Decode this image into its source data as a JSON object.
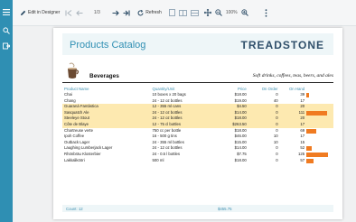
{
  "toolbar": {
    "edit_label": "Edit in Designer",
    "page_value": "1/3",
    "zoom_value": "100%",
    "refresh_label": "Refresh"
  },
  "report": {
    "title": "Products Catalog",
    "brand": "TREADSTONE",
    "category_name": "Beverages",
    "category_desc": "Soft drinks, coffees, teas, beers, and ales",
    "columns": [
      "Product Name",
      "Quantity/Unit",
      "Price",
      "On Order",
      "On Hand"
    ],
    "rows": [
      {
        "name": "Chai",
        "qty": "10 boxes x 20 bags",
        "price": "$18.00",
        "on_order": "0",
        "on_hand": "39"
      },
      {
        "name": "Chang",
        "qty": "24 - 12 oz bottles",
        "price": "$19.00",
        "on_order": "40",
        "on_hand": "17"
      },
      {
        "name": "Guaraná Fantástica",
        "qty": "12 - 355 ml cans",
        "price": "$4.50",
        "on_order": "0",
        "on_hand": "20"
      },
      {
        "name": "Sasquatch Ale",
        "qty": "24 - 12 oz bottles",
        "price": "$14.00",
        "on_order": "0",
        "on_hand": "111"
      },
      {
        "name": "Steeleye Stout",
        "qty": "24 - 12 oz bottles",
        "price": "$18.00",
        "on_order": "0",
        "on_hand": "20"
      },
      {
        "name": "Côte de Blaye",
        "qty": "12 - 75 cl bottles",
        "price": "$263.50",
        "on_order": "0",
        "on_hand": "17"
      },
      {
        "name": "Chartreuse verte",
        "qty": "750 cc per bottle",
        "price": "$18.00",
        "on_order": "0",
        "on_hand": "69"
      },
      {
        "name": "Ipoh Coffee",
        "qty": "16 - 500 g tins",
        "price": "$46.00",
        "on_order": "10",
        "on_hand": "17"
      },
      {
        "name": "Outback Lager",
        "qty": "24 - 355 ml bottles",
        "price": "$15.00",
        "on_order": "10",
        "on_hand": "15"
      },
      {
        "name": "Laughing Lumberjack Lager",
        "qty": "24 - 12 oz bottles",
        "price": "$14.00",
        "on_order": "0",
        "on_hand": "52"
      },
      {
        "name": "Rhönbräu Klosterbier",
        "qty": "24 - 0.5 l bottles",
        "price": "$7.75",
        "on_order": "0",
        "on_hand": "125"
      },
      {
        "name": "Lakkalikööri",
        "qty": "500 ml",
        "price": "$18.00",
        "on_order": "0",
        "on_hand": "57"
      }
    ],
    "highlight_rows": [
      2,
      3,
      4,
      5
    ],
    "footer_count": "Count: 12",
    "footer_total": "$455.75"
  },
  "colors": {
    "accent": "#2f8fb3",
    "bar": "#f07b21",
    "highlight": "#fde9b0"
  }
}
